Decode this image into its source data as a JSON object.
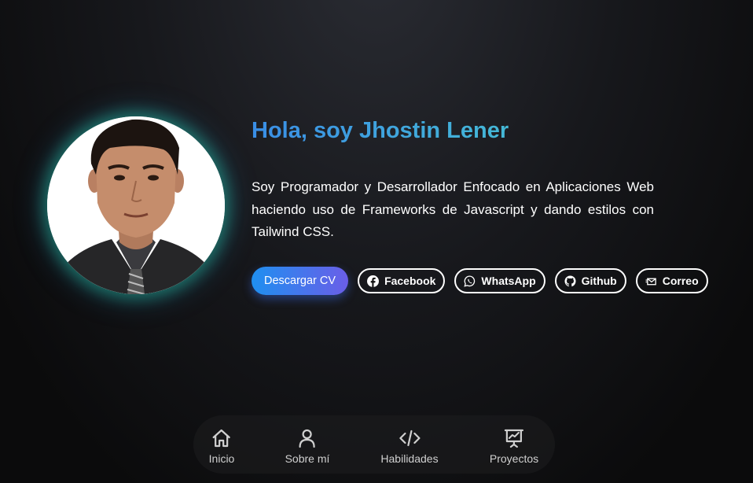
{
  "hero": {
    "greeting": "Hola, soy Jhostin Lener",
    "bio": "Soy Programador y Desarrollador Enfocado en Aplicaciones Web haciendo uso de Frameworks de Javascript y dando estilos con Tailwind CSS.",
    "download_label": "Descargar CV"
  },
  "social": [
    {
      "label": "Facebook",
      "icon": "facebook-icon"
    },
    {
      "label": "WhatsApp",
      "icon": "whatsapp-icon"
    },
    {
      "label": "Github",
      "icon": "github-icon"
    },
    {
      "label": "Correo",
      "icon": "mail-icon"
    }
  ],
  "nav": [
    {
      "label": "Inicio",
      "icon": "home-icon"
    },
    {
      "label": "Sobre mí",
      "icon": "user-icon"
    },
    {
      "label": "Habilidades",
      "icon": "code-icon"
    },
    {
      "label": "Proyectos",
      "icon": "presentation-chart-icon"
    }
  ],
  "colors": {
    "accent_start": "#1f8ff0",
    "accent_end": "#6a5ee8",
    "glow": "#26c4a0",
    "headline_start": "#3a8ee6",
    "headline_end": "#44b8d6"
  }
}
